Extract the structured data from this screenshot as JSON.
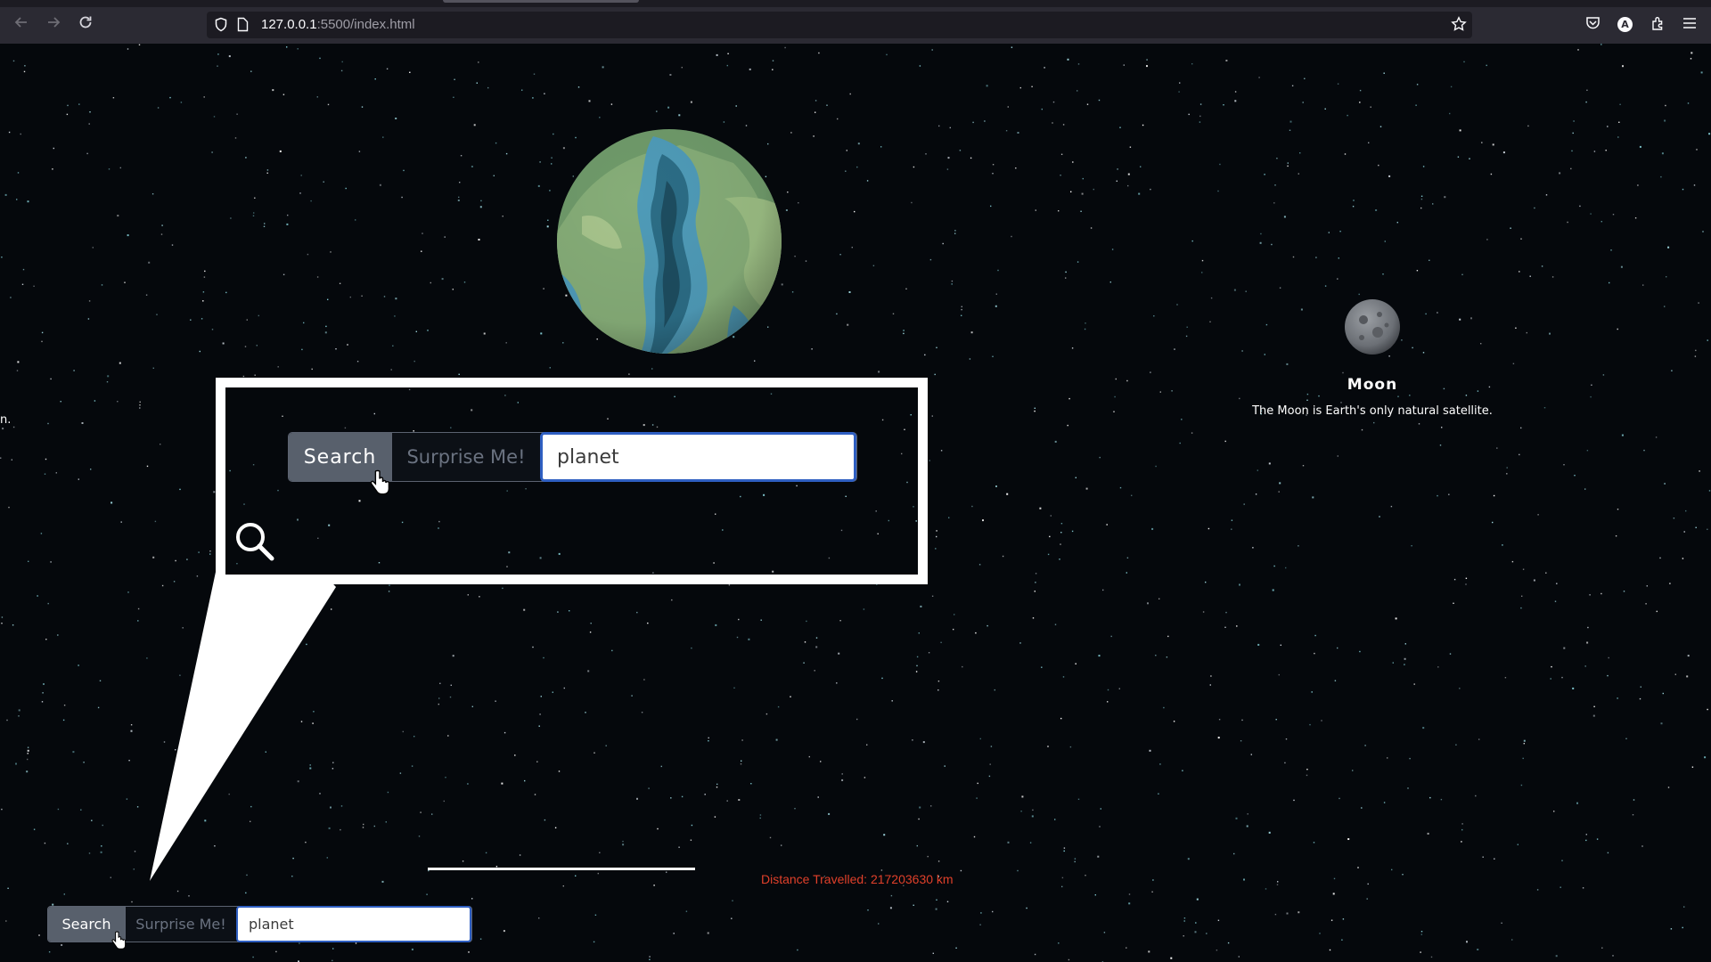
{
  "browser": {
    "url_host": "127.0.0.1",
    "url_rest": ":5500/index.html",
    "icons": [
      "back-arrow-icon",
      "forward-arrow-icon",
      "reload-icon",
      "shield-icon",
      "page-icon",
      "bookmark-star-icon",
      "pocket-icon",
      "account-icon",
      "extensions-icon",
      "menu-icon"
    ],
    "account_initial": "A"
  },
  "page": {
    "left_fragment": "n.",
    "moon": {
      "name": "Moon",
      "description": "The Moon is Earth's only natural satellite."
    },
    "distance": "Distance Travelled: 217203630 km",
    "search_bar": {
      "search_label": "Search",
      "surprise_label": "Surprise Me!",
      "input_value": "planet"
    }
  },
  "zoom_callout": {
    "search_label": "Search",
    "surprise_label": "Surprise Me!",
    "input_value": "planet",
    "icon": "magnifier-icon"
  },
  "colors": {
    "background": "#05080c",
    "search_button": "#58606c",
    "input_border": "#2f5fc2",
    "distance_text": "#e0402a",
    "chrome": "#2b2a33"
  }
}
